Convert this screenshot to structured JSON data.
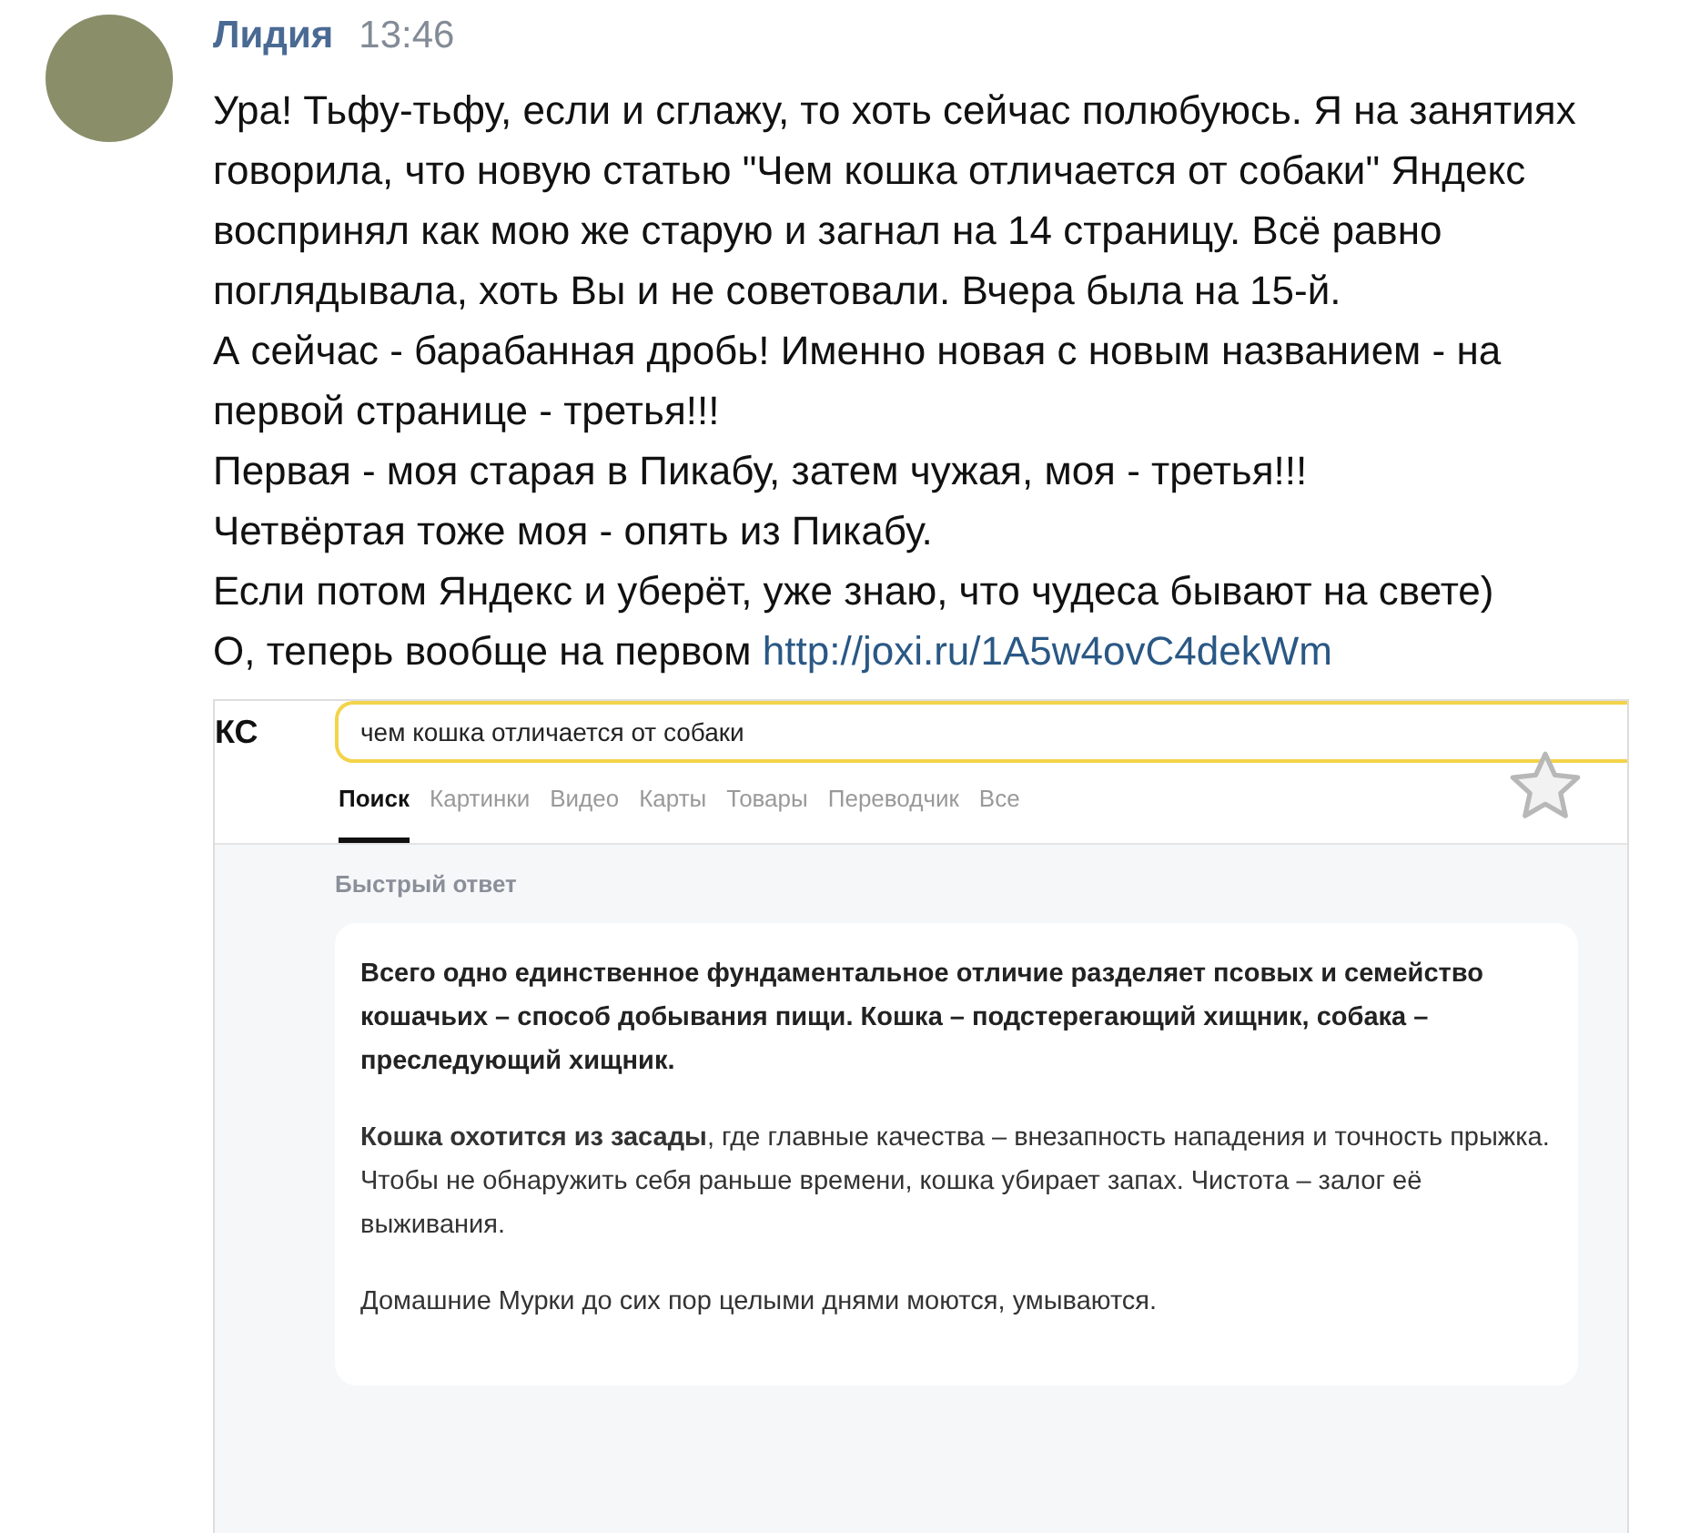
{
  "message": {
    "author": "Лидия",
    "time": "13:46",
    "lines": [
      {
        "text": "Ура! Тьфу-тьфу, если и сглажу, то хоть сейчас полюбуюсь. Я на занятиях говорила, что новую статью \"Чем кошка отличается от собаки\" Яндекс воспринял как мою же старую и загнал на 14 страницу. Всё равно поглядывала, хоть Вы и не советовали. Вчера была на 15-й."
      },
      {
        "text": "А сейчас - барабанная дробь! Именно новая с новым названием - на первой странице - третья!!!"
      },
      {
        "text": "Первая - моя старая в Пикабу, затем чужая, моя - третья!!!"
      },
      {
        "text": "Четвёртая тоже моя - опять из Пикабу."
      },
      {
        "text": "Если потом Яндекс и уберёт, уже знаю, что чудеса бывают на свете)"
      },
      {
        "text": "О, теперь вообще на первом",
        "link": "http://joxi.ru/1A5w4ovC4dekWm"
      }
    ]
  },
  "screenshot": {
    "logo": "КС",
    "search": {
      "value": "чем кошка отличается от собаки"
    },
    "tabs": [
      {
        "label": "Поиск",
        "selected": true
      },
      {
        "label": "Картинки",
        "selected": false
      },
      {
        "label": "Видео",
        "selected": false
      },
      {
        "label": "Карты",
        "selected": false
      },
      {
        "label": "Товары",
        "selected": false
      },
      {
        "label": "Переводчик",
        "selected": false
      },
      {
        "label": "Все",
        "selected": false
      }
    ],
    "answer_label": "Быстрый ответ",
    "paragraphs": [
      {
        "kind": "lead",
        "text": "Всего одно единственное фундаментальное отличие разделяет псовых и семейство кошачьих – способ добывания пищи. Кошка – подстерегающий хищник, собака – преследующий хищник."
      },
      {
        "kind": "body",
        "text": "**Кошка охотится из засады**, где главные качества – внезапность нападения и точность прыжка. Чтобы не обнаружить себя раньше времени, кошка убирает запах. Чистота – залог её выживания."
      },
      {
        "kind": "body",
        "text": "Домашние Мурки до сих пор целыми днями моются, умываются."
      }
    ]
  }
}
